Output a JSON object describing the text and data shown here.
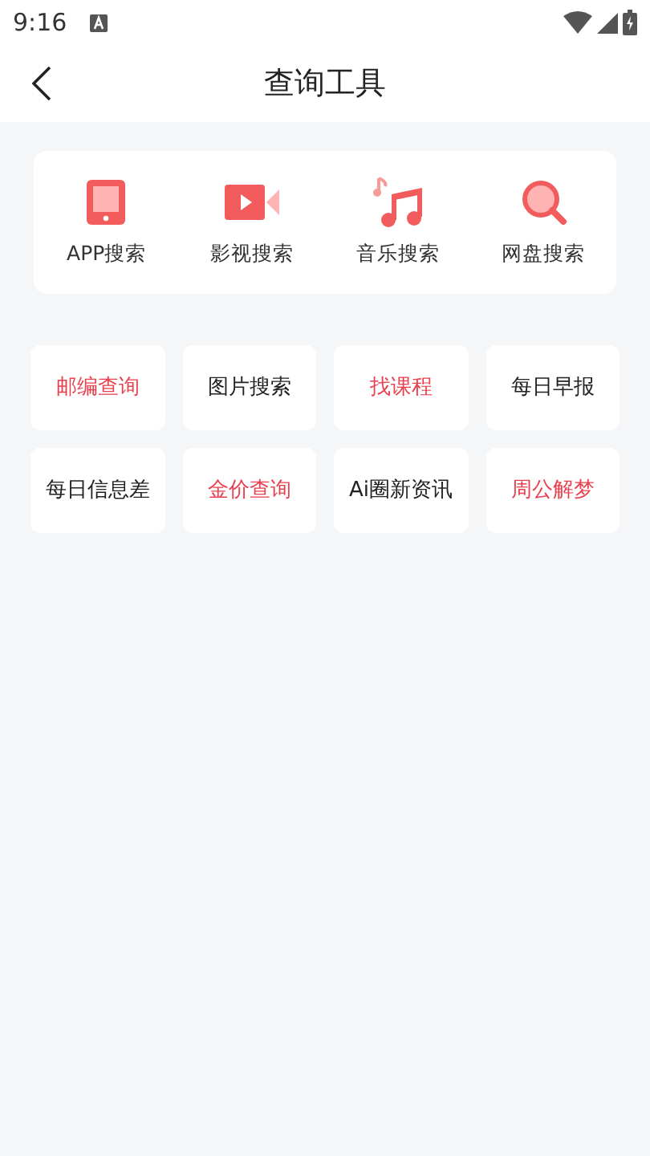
{
  "status_bar": {
    "time": "9:16"
  },
  "header": {
    "title": "查询工具"
  },
  "search_tools": [
    {
      "kind": "tablet",
      "label": "APP搜索"
    },
    {
      "kind": "video",
      "label": "影视搜索"
    },
    {
      "kind": "music",
      "label": "音乐搜索"
    },
    {
      "kind": "magnifier",
      "label": "网盘搜索"
    }
  ],
  "tools": [
    {
      "label": "邮编查询",
      "color": "#e8414f"
    },
    {
      "label": "图片搜索",
      "color": "#222222"
    },
    {
      "label": "找课程",
      "color": "#e8414f"
    },
    {
      "label": "每日早报",
      "color": "#222222"
    },
    {
      "label": "每日信息差",
      "color": "#222222"
    },
    {
      "label": "金价查询",
      "color": "#e8414f"
    },
    {
      "label": "Ai圈新资讯",
      "color": "#222222"
    },
    {
      "label": "周公解梦",
      "color": "#e8414f"
    }
  ]
}
